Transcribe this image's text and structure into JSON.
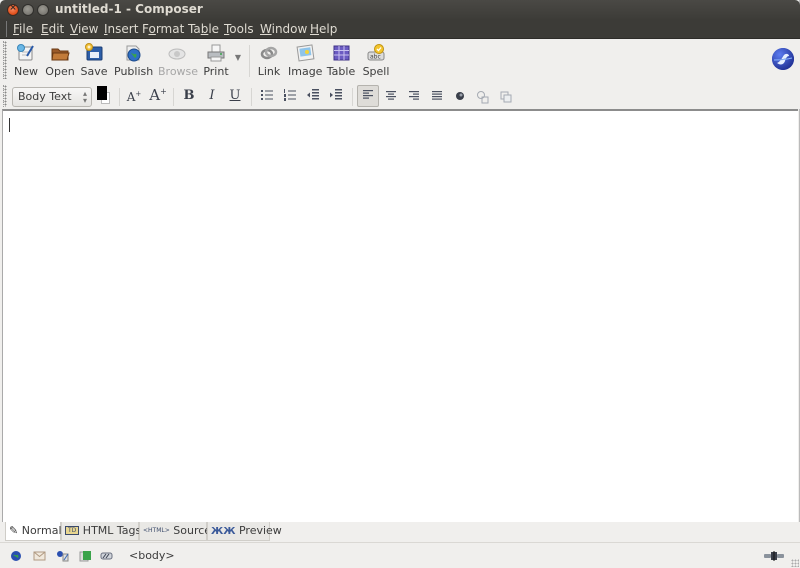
{
  "window": {
    "title": "untitled-1 - Composer",
    "controls": [
      "close",
      "minimize",
      "maximize"
    ]
  },
  "menubar": {
    "items": [
      {
        "label": "File",
        "mnemonic": "F"
      },
      {
        "label": "Edit",
        "mnemonic": "E"
      },
      {
        "label": "View",
        "mnemonic": "V"
      },
      {
        "label": "Insert",
        "mnemonic": "I"
      },
      {
        "label": "Format",
        "mnemonic": "o"
      },
      {
        "label": "Table",
        "mnemonic": "b"
      },
      {
        "label": "Tools",
        "mnemonic": "T"
      },
      {
        "label": "Window",
        "mnemonic": "W"
      },
      {
        "label": "Help",
        "mnemonic": "H"
      }
    ]
  },
  "toolbar": {
    "buttons": [
      {
        "label": "New",
        "icon": "new-document-icon",
        "enabled": true
      },
      {
        "label": "Open",
        "icon": "folder-icon",
        "enabled": true
      },
      {
        "label": "Save",
        "icon": "save-icon",
        "enabled": true
      },
      {
        "label": "Publish",
        "icon": "publish-globe-icon",
        "enabled": true
      },
      {
        "label": "Browse",
        "icon": "eye-icon",
        "enabled": false
      },
      {
        "label": "Print",
        "icon": "printer-icon",
        "enabled": true
      },
      {
        "label": "Link",
        "icon": "link-icon",
        "enabled": true
      },
      {
        "label": "Image",
        "icon": "image-icon",
        "enabled": true
      },
      {
        "label": "Table",
        "icon": "table-icon",
        "enabled": true
      },
      {
        "label": "Spell",
        "icon": "spellcheck-icon",
        "enabled": true
      }
    ],
    "brand_icon": "seamonkey-logo-icon"
  },
  "format_toolbar": {
    "paragraph_style": "Body Text",
    "text_color": "#000000",
    "buttons": [
      {
        "name": "smaller-font",
        "glyph": "A",
        "sup": "-"
      },
      {
        "name": "larger-font",
        "glyph": "A",
        "sup": "+"
      },
      {
        "name": "bold",
        "glyph": "B"
      },
      {
        "name": "italic",
        "glyph": "I"
      },
      {
        "name": "underline",
        "glyph": "U"
      },
      {
        "name": "bulleted-list",
        "glyph": "☰"
      },
      {
        "name": "numbered-list",
        "glyph": "☷"
      },
      {
        "name": "outdent",
        "glyph": "⇤"
      },
      {
        "name": "indent",
        "glyph": "⇥"
      },
      {
        "name": "align-left",
        "glyph": "≡",
        "active": true
      },
      {
        "name": "align-center",
        "glyph": "≡"
      },
      {
        "name": "align-right",
        "glyph": "≡"
      },
      {
        "name": "justify",
        "glyph": "≡"
      },
      {
        "name": "anchor",
        "glyph": "●"
      },
      {
        "name": "positioning",
        "glyph": "⧉"
      },
      {
        "name": "layer",
        "glyph": "⧉"
      }
    ]
  },
  "editor": {
    "content": ""
  },
  "edit_mode_tabs": [
    {
      "label": "Normal",
      "icon": "pencil-icon",
      "badge": "",
      "selected": true
    },
    {
      "label": "HTML Tags",
      "icon": "td-tag-icon",
      "badge": "TD",
      "selected": false
    },
    {
      "label": "Source",
      "icon": "html-source-icon",
      "badge": "<HTML>",
      "selected": false
    },
    {
      "label": "Preview",
      "icon": "preview-icon",
      "badge": "",
      "selected": false
    }
  ],
  "statusbar": {
    "icons": [
      "navigator-globe-icon",
      "mail-icon",
      "address-book-icon",
      "composer-icon",
      "chat-icon"
    ],
    "tag_path": "<body>",
    "connection_icon": "online-plug-icon"
  }
}
